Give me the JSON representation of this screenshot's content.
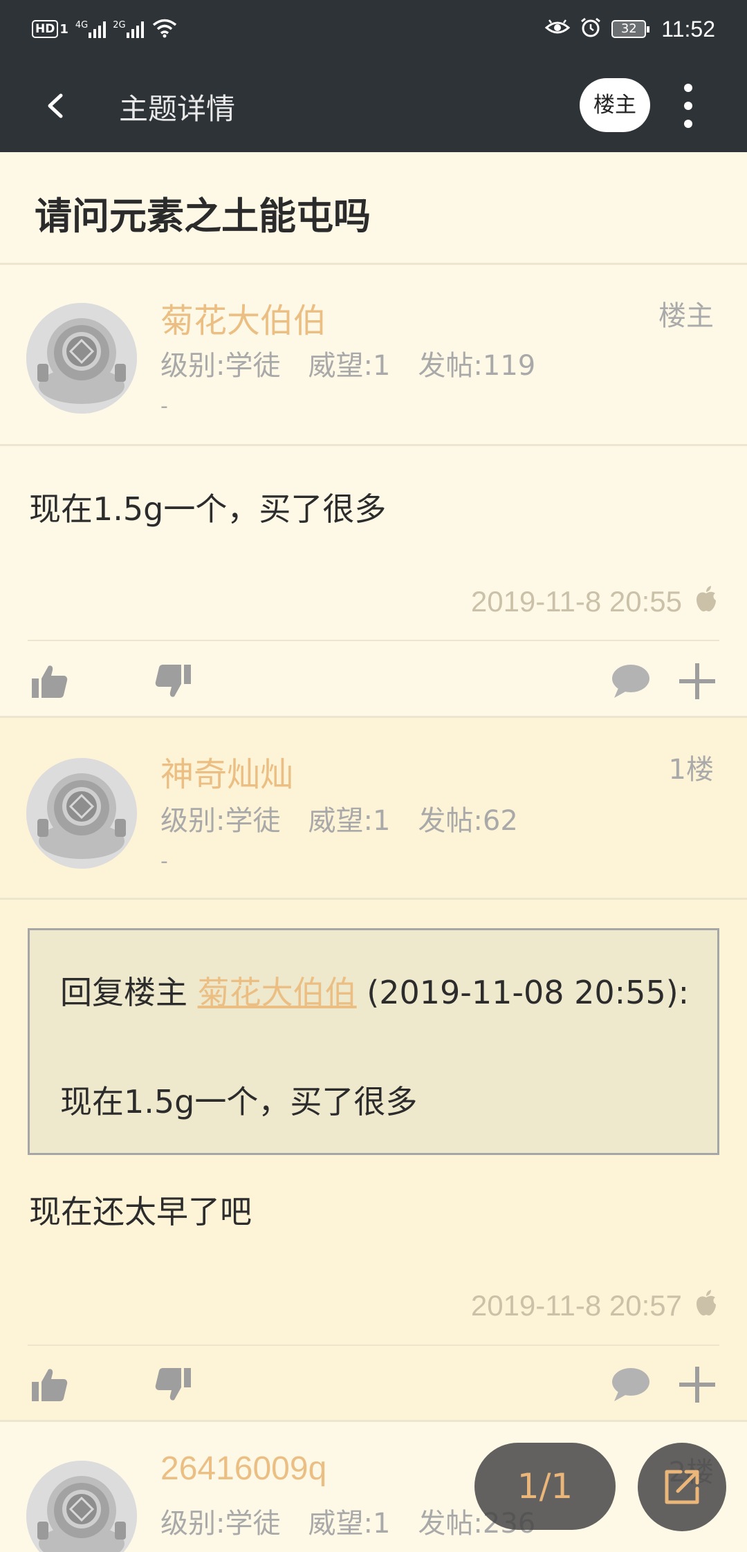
{
  "status_bar": {
    "hd_label": "HD",
    "sim_index": "1",
    "net1": "4G",
    "net2": "2G",
    "battery": "32",
    "time": "11:52"
  },
  "header": {
    "title": "主题详情",
    "op_button": "楼主"
  },
  "topic": {
    "title": "请问元素之土能屯吗"
  },
  "posts": [
    {
      "username": "菊花大伯伯",
      "floor": "楼主",
      "level": "级别:学徒",
      "prestige": "威望:1",
      "post_count": "发帖:119",
      "signature": "-",
      "content": "现在1.5g一个，买了很多",
      "time": "2019-11-8 20:55"
    },
    {
      "username": "神奇灿灿",
      "floor": "1楼",
      "level": "级别:学徒",
      "prestige": "威望:1",
      "post_count": "发帖:62",
      "signature": "-",
      "quote": {
        "prefix": "回复楼主",
        "user": "菊花大伯伯",
        "date": "(2019-11-08 20:55):",
        "text": "现在1.5g一个，买了很多"
      },
      "content": "现在还太早了吧",
      "time": "2019-11-8 20:57"
    },
    {
      "username": "26416009q",
      "floor": "2楼",
      "level": "级别:学徒",
      "prestige": "威望:1",
      "post_count": "发帖:236"
    }
  ],
  "pagination": {
    "label": "1/1"
  },
  "colors": {
    "appbar": "#2d3337",
    "background": "#fef8e6",
    "alt_background": "#fdf3d6",
    "username": "#ebbf84",
    "meta_text": "#a9a9a9",
    "icon_gray": "#9e9e9e"
  }
}
